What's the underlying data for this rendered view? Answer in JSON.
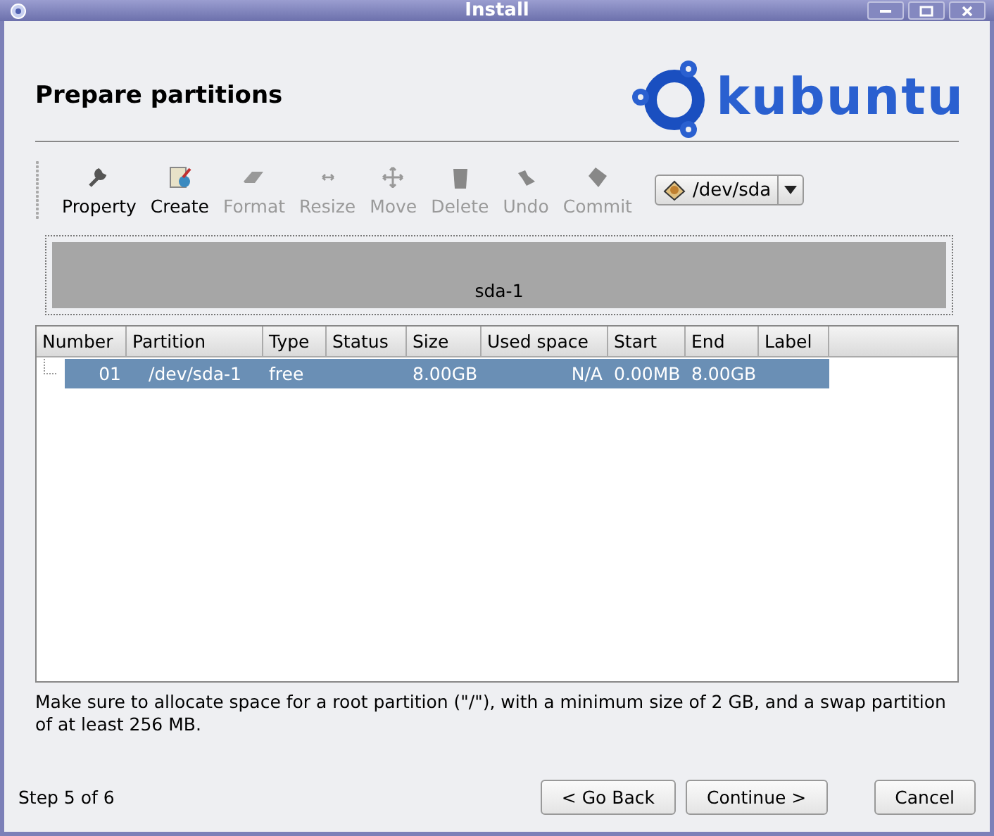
{
  "window": {
    "title": "Install"
  },
  "heading": "Prepare partitions",
  "logo": {
    "text": "kubuntu"
  },
  "toolbar": [
    {
      "label": "Property",
      "kind": "wrench",
      "disabled": false
    },
    {
      "label": "Create",
      "kind": "new",
      "disabled": false
    },
    {
      "label": "Format",
      "kind": "eraser",
      "disabled": true
    },
    {
      "label": "Resize",
      "kind": "resize",
      "disabled": true
    },
    {
      "label": "Move",
      "kind": "move",
      "disabled": true
    },
    {
      "label": "Delete",
      "kind": "trash",
      "disabled": true
    },
    {
      "label": "Undo",
      "kind": "undo",
      "disabled": true
    },
    {
      "label": "Commit",
      "kind": "commit",
      "disabled": true
    }
  ],
  "device": {
    "value": "/dev/sda"
  },
  "partition_bar": [
    {
      "label": "sda-1"
    }
  ],
  "table": {
    "columns": [
      "Number",
      "Partition",
      "Type",
      "Status",
      "Size",
      "Used space",
      "Start",
      "End",
      "Label"
    ],
    "rows": [
      {
        "selected": true,
        "cells": [
          "01",
          "/dev/sda-1",
          "free",
          "",
          "8.00GB",
          "N/A",
          "0.00MB",
          "8.00GB",
          ""
        ]
      }
    ]
  },
  "note": "Make sure to allocate space for a root partition (\"/\"), with a minimum size of 2 GB, and a swap partition of at least 256 MB.",
  "step": "Step 5 of 6",
  "buttons": [
    "< Go Back",
    "Continue >",
    "Cancel"
  ]
}
